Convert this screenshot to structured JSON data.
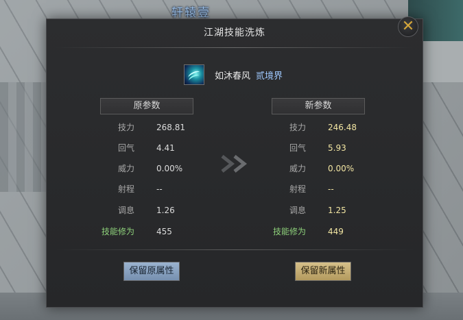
{
  "scene": {
    "location_label": "轩辕壹"
  },
  "dialog": {
    "title": "江湖技能洗炼",
    "close_label": "✕"
  },
  "skill": {
    "name": "如沐春风",
    "tier": "贰境界",
    "icon": "skill-wind-icon"
  },
  "columns": {
    "old_header": "原参数",
    "new_header": "新参数"
  },
  "params": [
    {
      "label": "技力",
      "old": "268.81",
      "new": "246.48",
      "highlight": false
    },
    {
      "label": "回气",
      "old": "4.41",
      "new": "5.93",
      "highlight": false
    },
    {
      "label": "威力",
      "old": "0.00%",
      "new": "0.00%",
      "highlight": false
    },
    {
      "label": "射程",
      "old": "--",
      "new": "--",
      "highlight": false
    },
    {
      "label": "调息",
      "old": "1.26",
      "new": "1.25",
      "highlight": false
    },
    {
      "label": "技能修为",
      "old": "455",
      "new": "449",
      "highlight": true
    }
  ],
  "buttons": {
    "keep_old": "保留原属性",
    "keep_new": "保留新属性"
  },
  "colors": {
    "old_value": "#dcdcdc",
    "new_value": "#f3e6a3",
    "highlight_label": "#8ed07a",
    "accent_gold": "#d4a63a"
  }
}
